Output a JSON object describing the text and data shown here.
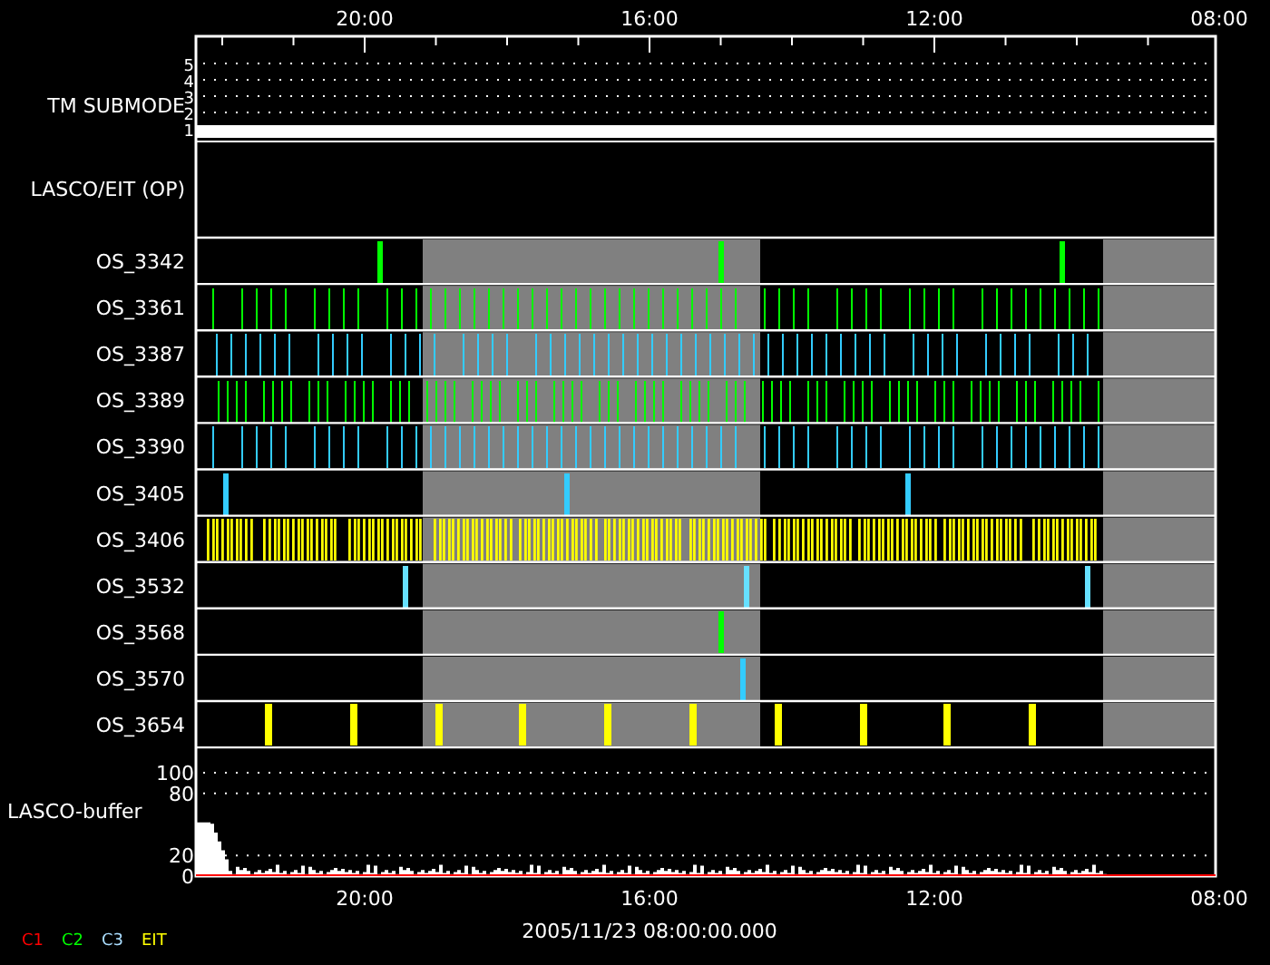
{
  "top_axis": {
    "ticks": [
      "20:00",
      "16:00",
      "12:00",
      "08:00"
    ]
  },
  "submode": {
    "label": "TM SUBMODE",
    "levels": [
      "5",
      "4",
      "3",
      "2",
      "1"
    ]
  },
  "op_panel": {
    "label": "LASCO/EIT (OP)"
  },
  "rows": [
    {
      "name": "OS_3342",
      "kind": "sparse",
      "color": "#00ff00"
    },
    {
      "name": "OS_3361",
      "kind": "regular",
      "color": "#00ff00"
    },
    {
      "name": "OS_3387",
      "kind": "regular",
      "color": "#33ccff"
    },
    {
      "name": "OS_3389",
      "kind": "dense",
      "color": "#00ff00"
    },
    {
      "name": "OS_3390",
      "kind": "regular",
      "color": "#33ccff"
    },
    {
      "name": "OS_3405",
      "kind": "sparse",
      "color": "#33ccff"
    },
    {
      "name": "OS_3406",
      "kind": "packed",
      "color": "#ffff00"
    },
    {
      "name": "OS_3532",
      "kind": "sparse",
      "color": "#66e0ff"
    },
    {
      "name": "OS_3568",
      "kind": "sparse",
      "color": "#00ff00"
    },
    {
      "name": "OS_3570",
      "kind": "sparse",
      "color": "#33ccff"
    },
    {
      "name": "OS_3654",
      "kind": "band",
      "color": "#ffff00"
    }
  ],
  "buffer": {
    "label": "LASCO-buffer",
    "yticks": [
      "100",
      "80",
      "20",
      "0"
    ]
  },
  "bottom_axis": {
    "ticks": [
      "20:00",
      "16:00",
      "12:00",
      "08:00"
    ],
    "date": "2005/11/23 08:00:00.000"
  },
  "legend": [
    {
      "label": "C1",
      "color": "#ff0000"
    },
    {
      "label": "C2",
      "color": "#00ff00"
    },
    {
      "label": "C3",
      "color": "#aaddff"
    },
    {
      "label": "EIT",
      "color": "#ffff00"
    }
  ]
}
